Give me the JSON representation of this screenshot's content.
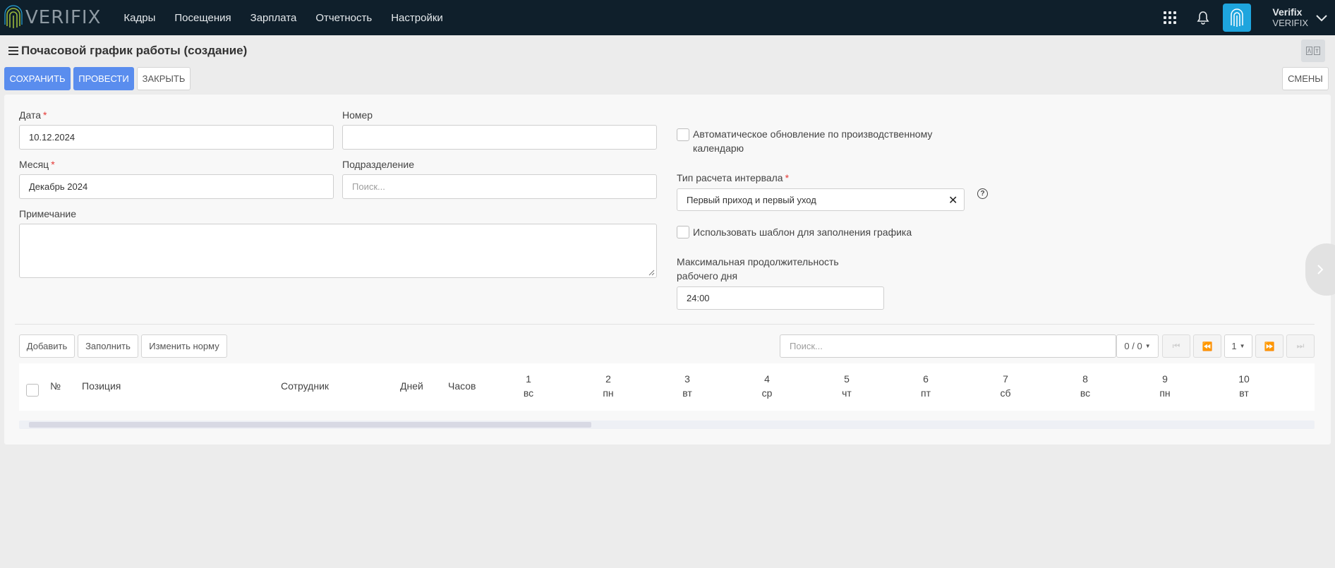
{
  "app": {
    "logo_text": "VERIFIX",
    "nav": [
      "Кадры",
      "Посещения",
      "Зарплата",
      "Отчетность",
      "Настройки"
    ],
    "user": {
      "name": "Verifix",
      "company": "VERIFIX"
    }
  },
  "page": {
    "title": "Почасовой график работы (создание)"
  },
  "toolbar": {
    "save": "Сохранить",
    "post": "Провести",
    "close": "Закрыть",
    "shifts": "Смены"
  },
  "form": {
    "date_label": "Дата",
    "date_value": "10.12.2024",
    "number_label": "Номер",
    "number_value": "",
    "month_label": "Месяц",
    "month_value": "Декабрь 2024",
    "division_label": "Подразделение",
    "division_placeholder": "Поиск...",
    "note_label": "Примечание",
    "auto_update_label_1": "Автоматическое обновление по производственному",
    "auto_update_label_2": "календарю",
    "interval_label": "Тип расчета интервала",
    "interval_value": "Первый приход и первый уход",
    "template_label": "Использовать шаблон для заполнения графика",
    "max_duration_label_1": "Максимальная продолжительность",
    "max_duration_label_2": "рабочего дня",
    "max_duration_value": "24:00",
    "required_mark": "*"
  },
  "grid": {
    "add": "Добавить",
    "fill": "Заполнить",
    "change_norm": "Изменить норму",
    "search_placeholder": "Поиск...",
    "counter": "0 / 0",
    "page": "1",
    "columns": {
      "num": "№",
      "position": "Позиция",
      "employee": "Сотрудник",
      "days": "Дней",
      "hours": "Часов"
    },
    "days": [
      {
        "n": "1",
        "wd": "вс"
      },
      {
        "n": "2",
        "wd": "пн"
      },
      {
        "n": "3",
        "wd": "вт"
      },
      {
        "n": "4",
        "wd": "ср"
      },
      {
        "n": "5",
        "wd": "чт"
      },
      {
        "n": "6",
        "wd": "пт"
      },
      {
        "n": "7",
        "wd": "сб"
      },
      {
        "n": "8",
        "wd": "вс"
      },
      {
        "n": "9",
        "wd": "пн"
      },
      {
        "n": "10",
        "wd": "вт"
      }
    ]
  }
}
